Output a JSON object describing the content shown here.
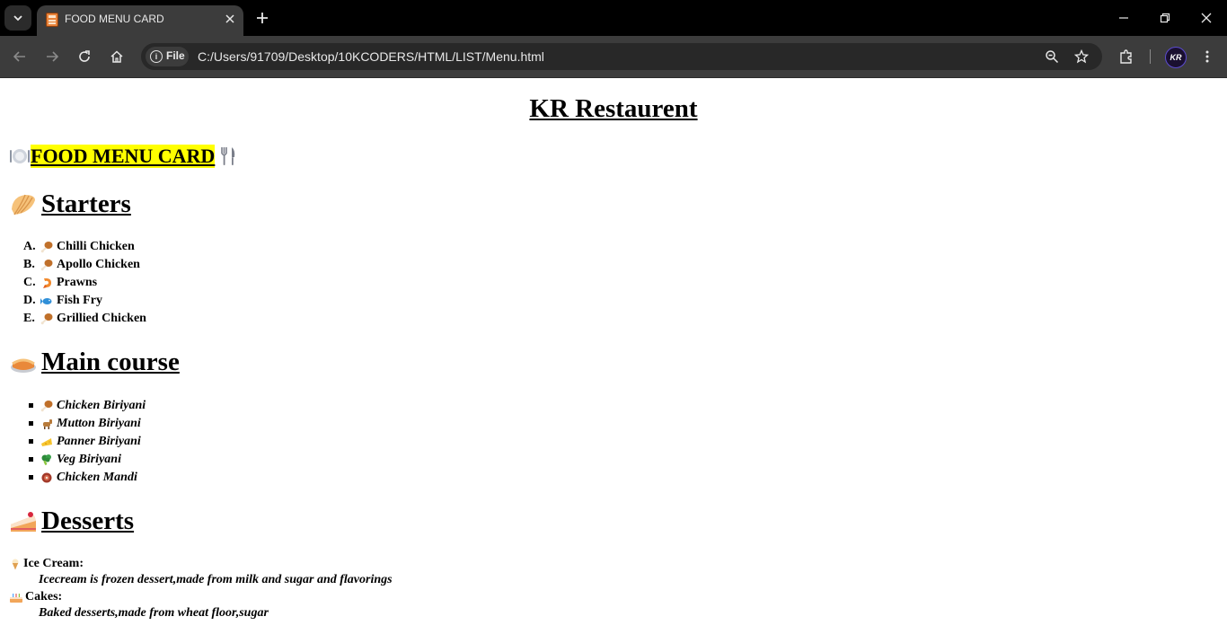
{
  "browser": {
    "tab_title": "FOOD MENU CARD",
    "site_chip": "File",
    "url": "C:/Users/91709/Desktop/10KCODERS/HTML/LIST/Menu.html",
    "avatar_initials": "KR"
  },
  "page": {
    "title": "KR Restaurent",
    "menu_card_title": "FOOD MENU CARD",
    "sections": {
      "starters": {
        "heading": "Starters",
        "items": [
          {
            "marker": "A.",
            "icon": "drumstick-icon",
            "label": "Chilli Chicken"
          },
          {
            "marker": "B.",
            "icon": "drumstick-icon",
            "label": "Apollo Chicken"
          },
          {
            "marker": "C.",
            "icon": "shrimp-icon",
            "label": "Prawns"
          },
          {
            "marker": "D.",
            "icon": "fish-icon",
            "label": "Fish Fry"
          },
          {
            "marker": "E.",
            "icon": "drumstick-icon",
            "label": "Grillied Chicken"
          }
        ]
      },
      "main_course": {
        "heading": "Main course",
        "items": [
          {
            "icon": "drumstick-icon",
            "label": "Chicken Biriyani"
          },
          {
            "icon": "goat-icon",
            "label": "Mutton Biriyani"
          },
          {
            "icon": "cheese-icon",
            "label": "Panner Biriyani"
          },
          {
            "icon": "broccoli-icon",
            "label": "Veg Biriyani"
          },
          {
            "icon": "meat-icon",
            "label": "Chicken Mandi"
          }
        ]
      },
      "desserts": {
        "heading": "Desserts",
        "items": [
          {
            "icon": "ice-cream-icon",
            "term": "Ice Cream:",
            "description": "Icecream is frozen dessert,made from milk and sugar and flavorings"
          },
          {
            "icon": "birthday-cake-icon",
            "term": "Cakes:",
            "description": "Baked desserts,made from wheat floor,sugar"
          }
        ]
      }
    }
  },
  "colors": {
    "highlight": "#ffff00",
    "tabbar_bg": "#000000",
    "toolbar_bg": "#3c3c3c",
    "omnibox_bg": "#282828"
  }
}
